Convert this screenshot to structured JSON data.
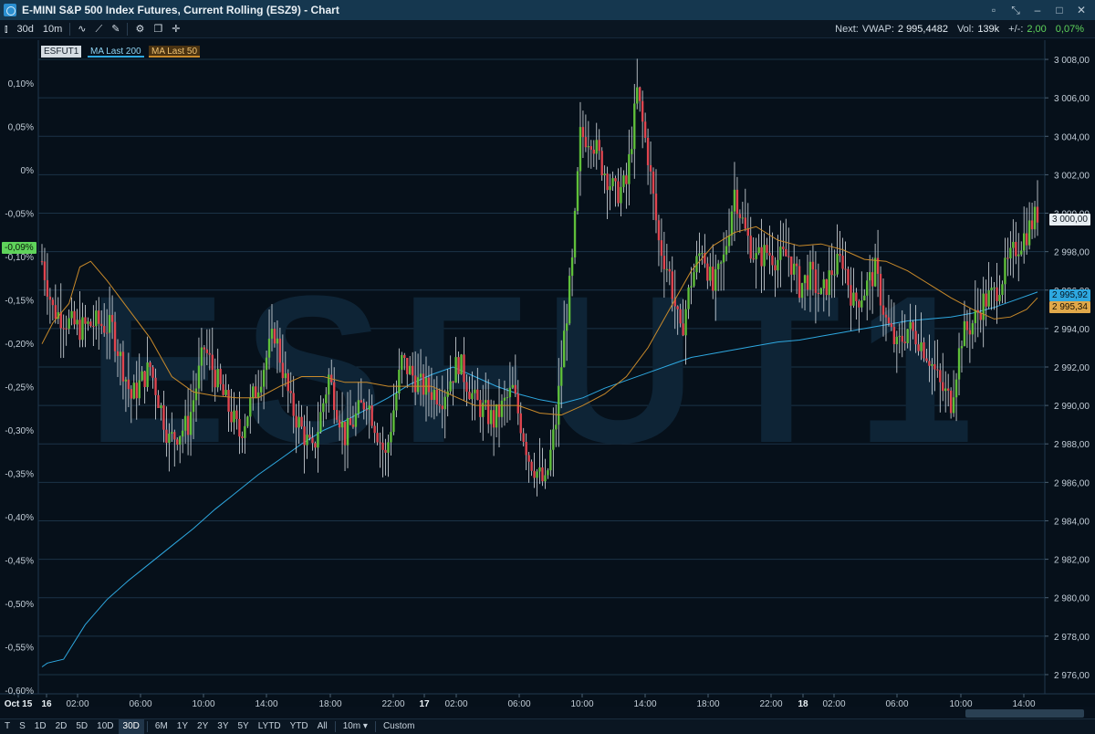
{
  "window": {
    "title": "E-MINI S&P 500 Index Futures, Current Rolling (ESZ9) - Chart"
  },
  "toolbar": {
    "period": "30d",
    "interval": "10m",
    "stats": {
      "next_label": "Next:",
      "vwap_label": "VWAP:",
      "vwap": "2 995,4482",
      "vol_label": "Vol:",
      "vol": "139k",
      "change_label": "+/-:",
      "change": "2,00",
      "change_pct": "0,07%"
    }
  },
  "legend": {
    "instrument": "ESFUT1",
    "ma200": "MA Last 200",
    "ma50": "MA Last 50"
  },
  "watermark": "ESFUT1",
  "colors": {
    "up": "#5fbf3a",
    "down": "#e0454f",
    "ma200": "#2ea8e0",
    "ma50": "#c98a2a",
    "grid": "#1b3347",
    "price_tag": "#e8eef3"
  },
  "chart_data": {
    "type": "candlestick",
    "y_right_ticks": [
      "3 008,00",
      "3 006,00",
      "3 004,00",
      "3 002,00",
      "3 000,00",
      "2 998,00",
      "2 996,00",
      "2 994,00",
      "2 992,00",
      "2 990,00",
      "2 988,00",
      "2 986,00",
      "2 984,00",
      "2 982,00",
      "2 980,00",
      "2 978,00",
      "2 976,00"
    ],
    "y_left_ticks": [
      "0,10%",
      "0,05%",
      "0%",
      "-0,05%",
      "-0,10%",
      "-0,15%",
      "-0,20%",
      "-0,25%",
      "-0,30%",
      "-0,35%",
      "-0,40%",
      "-0,45%",
      "-0,50%",
      "-0,55%",
      "-0,60%"
    ],
    "x_ticks": [
      {
        "label": "Oct 15",
        "bold": true
      },
      {
        "label": "16",
        "bold": true
      },
      {
        "label": "02:00",
        "bold": false
      },
      {
        "label": "06:00",
        "bold": false
      },
      {
        "label": "10:00",
        "bold": false
      },
      {
        "label": "14:00",
        "bold": false
      },
      {
        "label": "18:00",
        "bold": false
      },
      {
        "label": "22:00",
        "bold": false
      },
      {
        "label": "17",
        "bold": true
      },
      {
        "label": "02:00",
        "bold": false
      },
      {
        "label": "06:00",
        "bold": false
      },
      {
        "label": "10:00",
        "bold": false
      },
      {
        "label": "14:00",
        "bold": false
      },
      {
        "label": "18:00",
        "bold": false
      },
      {
        "label": "22:00",
        "bold": false
      },
      {
        "label": "18",
        "bold": true
      },
      {
        "label": "02:00",
        "bold": false
      },
      {
        "label": "06:00",
        "bold": false
      },
      {
        "label": "10:00",
        "bold": false
      },
      {
        "label": "14:00",
        "bold": false
      }
    ],
    "ylim": [
      2975,
      3009
    ],
    "price_path": [
      [
        0,
        2997.5
      ],
      [
        4,
        2995.0
      ],
      [
        10,
        2994.3
      ],
      [
        14,
        2994.0
      ],
      [
        20,
        2994.3
      ],
      [
        26,
        2994.0
      ],
      [
        33,
        2990.4
      ],
      [
        40,
        2992.0
      ],
      [
        47,
        2988.2
      ],
      [
        54,
        2989.0
      ],
      [
        60,
        2993.0
      ],
      [
        67,
        2990.5
      ],
      [
        73,
        2988.5
      ],
      [
        80,
        2991.2
      ],
      [
        86,
        2993.8
      ],
      [
        92,
        2990.0
      ],
      [
        100,
        2987.5
      ],
      [
        106,
        2991.5
      ],
      [
        112,
        2988.4
      ],
      [
        120,
        2990.4
      ],
      [
        127,
        2987.3
      ],
      [
        133,
        2992.3
      ],
      [
        140,
        2991.0
      ],
      [
        148,
        2990.5
      ],
      [
        154,
        2992.3
      ],
      [
        160,
        2990.2
      ],
      [
        167,
        2989.2
      ],
      [
        174,
        2990.8
      ],
      [
        180,
        2987.3
      ],
      [
        186,
        2985.8
      ],
      [
        190,
        2989.2
      ],
      [
        193,
        2993.6
      ],
      [
        196,
        2997.3
      ],
      [
        199,
        3004.0
      ],
      [
        203,
        3004.0
      ],
      [
        207,
        3002.5
      ],
      [
        212,
        3001.0
      ],
      [
        216,
        3001.5
      ],
      [
        220,
        3006.3
      ],
      [
        224,
        3003.0
      ],
      [
        228,
        2998.5
      ],
      [
        232,
        2996.8
      ],
      [
        236,
        2993.6
      ],
      [
        240,
        2996.5
      ],
      [
        244,
        2998.3
      ],
      [
        248,
        2996.0
      ],
      [
        252,
        2997.6
      ],
      [
        256,
        3001.2
      ],
      [
        260,
        2999.0
      ],
      [
        264,
        2997.6
      ],
      [
        268,
        2998.0
      ],
      [
        272,
        2997.6
      ],
      [
        276,
        2997.8
      ],
      [
        280,
        2996.2
      ],
      [
        284,
        2996.8
      ],
      [
        288,
        2995.6
      ],
      [
        292,
        2997.0
      ],
      [
        296,
        2997.6
      ],
      [
        300,
        2995.3
      ],
      [
        304,
        2996.0
      ],
      [
        308,
        2997.0
      ],
      [
        312,
        2994.4
      ],
      [
        316,
        2993.0
      ],
      [
        320,
        2994.0
      ],
      [
        324,
        2993.5
      ],
      [
        328,
        2992.5
      ],
      [
        332,
        2991.0
      ],
      [
        336,
        2990.2
      ],
      [
        340,
        2993.6
      ],
      [
        344,
        2994.3
      ],
      [
        348,
        2995.4
      ],
      [
        352,
        2995.8
      ],
      [
        356,
        2997.0
      ],
      [
        360,
        2998.2
      ],
      [
        364,
        2999.0
      ],
      [
        368,
        3000.0
      ]
    ],
    "ma50_path": [
      [
        0,
        2993.2
      ],
      [
        4,
        2994.3
      ],
      [
        10,
        2995.3
      ],
      [
        14,
        2997.2
      ],
      [
        18,
        2997.5
      ],
      [
        24,
        2996.5
      ],
      [
        32,
        2995.0
      ],
      [
        40,
        2993.5
      ],
      [
        48,
        2991.5
      ],
      [
        56,
        2990.7
      ],
      [
        64,
        2990.5
      ],
      [
        72,
        2990.4
      ],
      [
        80,
        2990.4
      ],
      [
        88,
        2991.0
      ],
      [
        96,
        2991.5
      ],
      [
        104,
        2991.5
      ],
      [
        112,
        2991.2
      ],
      [
        120,
        2991.2
      ],
      [
        128,
        2991.0
      ],
      [
        136,
        2991.0
      ],
      [
        144,
        2991.0
      ],
      [
        152,
        2990.5
      ],
      [
        160,
        2990.0
      ],
      [
        168,
        2990.0
      ],
      [
        176,
        2990.0
      ],
      [
        184,
        2989.6
      ],
      [
        192,
        2989.5
      ],
      [
        200,
        2990.0
      ],
      [
        208,
        2990.6
      ],
      [
        216,
        2991.5
      ],
      [
        224,
        2993.0
      ],
      [
        232,
        2995.0
      ],
      [
        240,
        2997.0
      ],
      [
        248,
        2998.3
      ],
      [
        256,
        2999.0
      ],
      [
        264,
        2999.3
      ],
      [
        272,
        2998.6
      ],
      [
        280,
        2998.3
      ],
      [
        288,
        2998.4
      ],
      [
        296,
        2998.1
      ],
      [
        304,
        2997.6
      ],
      [
        312,
        2997.5
      ],
      [
        320,
        2997.0
      ],
      [
        328,
        2996.3
      ],
      [
        336,
        2995.6
      ],
      [
        344,
        2995.0
      ],
      [
        352,
        2994.5
      ],
      [
        358,
        2994.6
      ],
      [
        364,
        2995.0
      ],
      [
        368,
        2995.6
      ]
    ],
    "ma200_path": [
      [
        0,
        2976.4
      ],
      [
        2,
        2976.6
      ],
      [
        8,
        2976.8
      ],
      [
        16,
        2978.6
      ],
      [
        24,
        2979.9
      ],
      [
        32,
        2980.9
      ],
      [
        40,
        2981.8
      ],
      [
        48,
        2982.7
      ],
      [
        56,
        2983.6
      ],
      [
        64,
        2984.6
      ],
      [
        72,
        2985.5
      ],
      [
        80,
        2986.4
      ],
      [
        88,
        2987.2
      ],
      [
        96,
        2988.0
      ],
      [
        104,
        2988.7
      ],
      [
        112,
        2989.2
      ],
      [
        120,
        2989.8
      ],
      [
        128,
        2990.4
      ],
      [
        136,
        2991.1
      ],
      [
        144,
        2991.6
      ],
      [
        152,
        2992.0
      ],
      [
        160,
        2991.5
      ],
      [
        168,
        2991.0
      ],
      [
        176,
        2990.6
      ],
      [
        184,
        2990.3
      ],
      [
        192,
        2990.1
      ],
      [
        200,
        2990.4
      ],
      [
        208,
        2990.9
      ],
      [
        216,
        2991.3
      ],
      [
        224,
        2991.7
      ],
      [
        232,
        2992.1
      ],
      [
        240,
        2992.5
      ],
      [
        248,
        2992.7
      ],
      [
        256,
        2992.9
      ],
      [
        264,
        2993.1
      ],
      [
        272,
        2993.3
      ],
      [
        280,
        2993.4
      ],
      [
        288,
        2993.6
      ],
      [
        296,
        2993.8
      ],
      [
        304,
        2994.0
      ],
      [
        312,
        2994.2
      ],
      [
        320,
        2994.4
      ],
      [
        328,
        2994.5
      ],
      [
        336,
        2994.6
      ],
      [
        344,
        2994.8
      ],
      [
        352,
        2995.1
      ],
      [
        360,
        2995.5
      ],
      [
        368,
        2995.9
      ]
    ],
    "last_price": "3 000,00",
    "ma200_last": "2 995,92",
    "ma50_last": "2 995,34",
    "pct_marker": "-0,09%"
  },
  "range_bar": {
    "items": [
      "T",
      "S",
      "1D",
      "2D",
      "5D",
      "10D",
      "30D",
      "6M",
      "1Y",
      "2Y",
      "3Y",
      "5Y",
      "LYTD",
      "YTD",
      "All"
    ],
    "active": "30D",
    "interval": "10m",
    "custom": "Custom"
  }
}
